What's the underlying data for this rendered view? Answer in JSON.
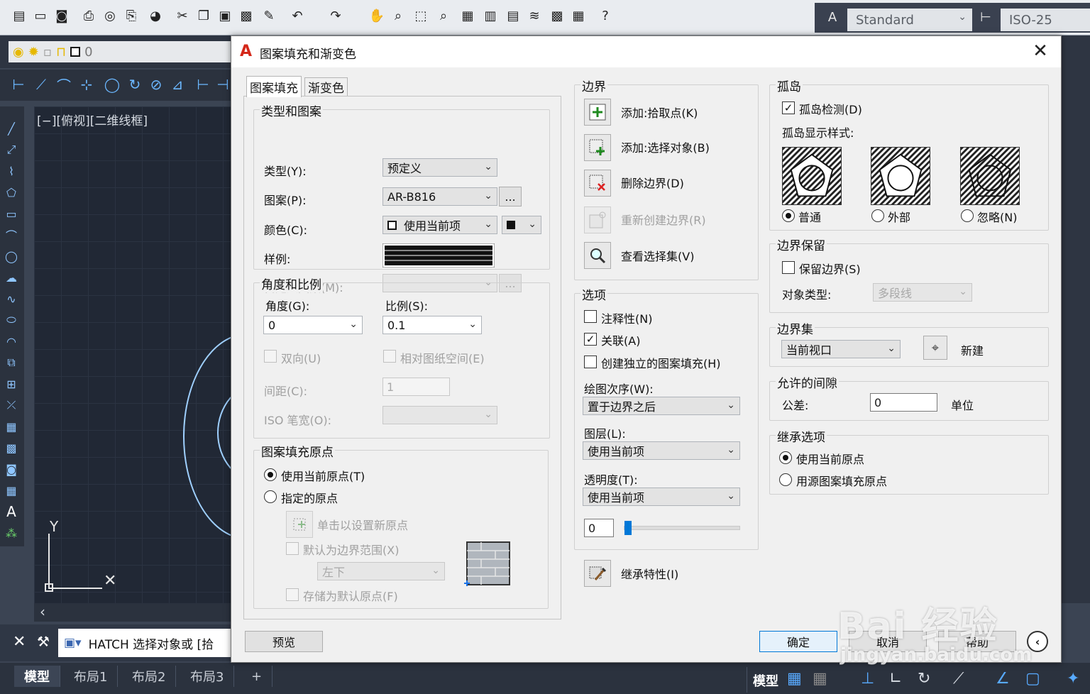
{
  "app": {
    "style_combo": "Standard",
    "dim_combo": "ISO-25",
    "layer_value": "0",
    "view_label": "[−][俯视][二维线框]",
    "ucs_y": "Y",
    "command_text": "HATCH 选择对象或 [拾",
    "layout_tabs": [
      "模型",
      "布局1",
      "布局2",
      "布局3"
    ],
    "add_tab": "+",
    "status_model": "模型",
    "watermark_brand": "Bai 经验",
    "watermark_url": "jingyan.baidu.com"
  },
  "dialog": {
    "title": "图案填充和渐变色",
    "tabs": [
      "图案填充",
      "渐变色"
    ],
    "type_pattern": {
      "legend": "类型和图案",
      "type_label": "类型(Y):",
      "type_value": "预定义",
      "pattern_label": "图案(P):",
      "pattern_value": "AR-B816",
      "browse": "...",
      "color_label": "颜色(C):",
      "color_value": "使用当前项",
      "sample_label": "样例:",
      "custom_label": "自定义图案(M):",
      "custom_browse": "..."
    },
    "angle_scale": {
      "legend": "角度和比例",
      "angle_label": "角度(G):",
      "angle_value": "0",
      "scale_label": "比例(S):",
      "scale_value": "0.1",
      "double_label": "双向(U)",
      "relative_label": "相对图纸空间(E)",
      "spacing_label": "间距(C):",
      "spacing_value": "1",
      "iso_label": "ISO 笔宽(O):"
    },
    "origin": {
      "legend": "图案填充原点",
      "use_current": "使用当前原点(T)",
      "specified": "指定的原点",
      "click_set": "单击以设置新原点",
      "default_extent": "默认为边界范围(X)",
      "extent_value": "左下",
      "store_default": "存储为默认原点(F)"
    },
    "boundary": {
      "legend": "边界",
      "add_pick": "添加:拾取点(K)",
      "add_select": "添加:选择对象(B)",
      "remove": "删除边界(D)",
      "recreate": "重新创建边界(R)",
      "view_sel": "查看选择集(V)"
    },
    "options": {
      "legend": "选项",
      "annotative": "注释性(N)",
      "associative": "关联(A)",
      "separate": "创建独立的图案填充(H)",
      "draw_order_label": "绘图次序(W):",
      "draw_order_value": "置于边界之后",
      "layer_label": "图层(L):",
      "layer_value": "使用当前项",
      "transparency_label": "透明度(T):",
      "transparency_value": "使用当前项",
      "transparency_num": "0",
      "transparency_slider_fraction": 0.0
    },
    "inherit_props": "继承特性(I)",
    "islands": {
      "legend": "孤岛",
      "detect": "孤岛检测(D)",
      "display_style": "孤岛显示样式:",
      "normal": "普通",
      "outer": "外部",
      "ignore": "忽略(N)"
    },
    "retain": {
      "legend": "边界保留",
      "retain_label": "保留边界(S)",
      "object_type_label": "对象类型:",
      "object_type_value": "多段线"
    },
    "boundary_set": {
      "legend": "边界集",
      "value": "当前视口",
      "new_label": "新建"
    },
    "gap": {
      "legend": "允许的间隙",
      "tol_label": "公差:",
      "tol_value": "0",
      "unit": "单位"
    },
    "inherit_opts": {
      "legend": "继承选项",
      "use_current": "使用当前原点",
      "use_source": "用源图案填充原点"
    },
    "buttons": {
      "preview": "预览",
      "ok": "确定",
      "cancel": "取消",
      "help": "帮助"
    }
  },
  "colors": {
    "accent_blue": "#0078d7",
    "autocad_red": "#d4281a",
    "canvas_bg": "#212835"
  }
}
